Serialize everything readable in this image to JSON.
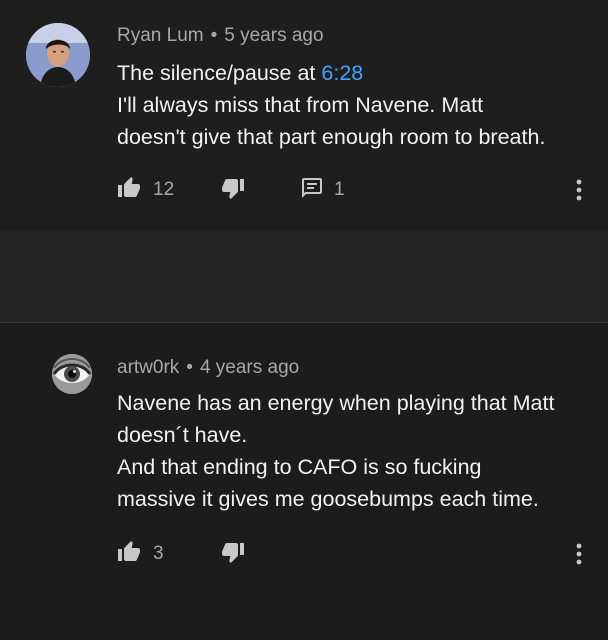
{
  "comments": [
    {
      "author": "Ryan Lum",
      "separator": "•",
      "time": "5 years ago",
      "text_line1_prefix": "The silence/pause at ",
      "timestamp": "6:28",
      "text_line2": "I'll always miss that from Navene. Matt",
      "text_line3": "doesn't give that part enough room to breath.",
      "likes": "12",
      "replies": "1",
      "avatar_icon": "person-photo-icon"
    },
    {
      "author": "artw0rk",
      "separator": "•",
      "time": "4 years ago",
      "text_line1": "Navene has an energy when playing that Matt",
      "text_line2": "doesn´t have.",
      "text_line3": "And that ending to CAFO is so fucking",
      "text_line4": "massive it gives me goosebumps each time.",
      "likes": "3",
      "avatar_icon": "eye-icon"
    }
  ],
  "colors": {
    "background": "#212121",
    "link": "#3ea6ff",
    "text": "#f1f1f1",
    "meta": "#a8a8a8"
  },
  "icons": [
    "thumbs-up-icon",
    "thumbs-down-icon",
    "comment-icon",
    "more-vert-icon"
  ]
}
